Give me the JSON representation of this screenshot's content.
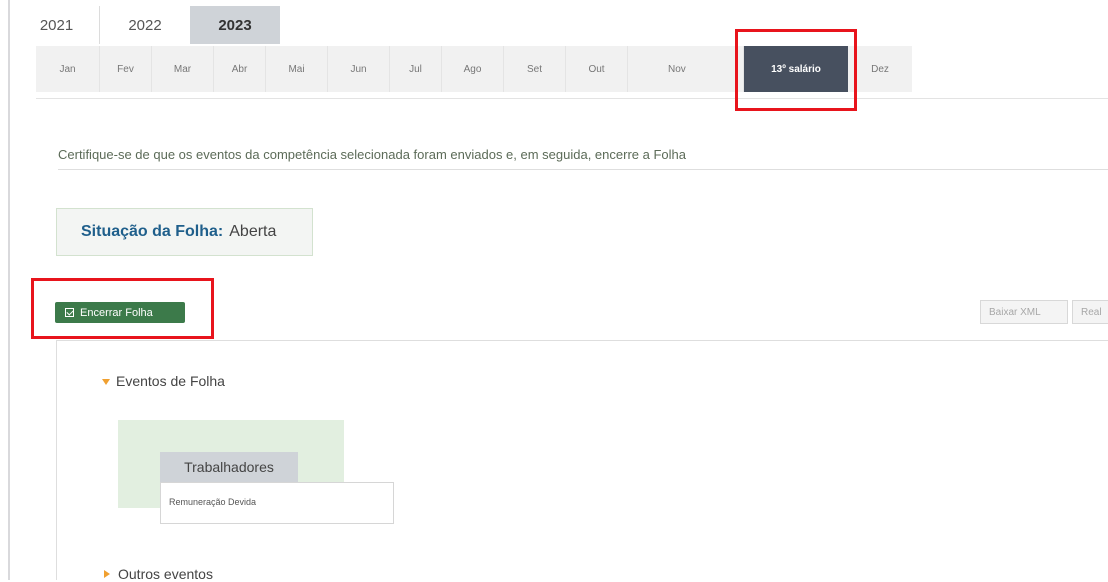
{
  "years": [
    {
      "label": "2021",
      "active": false
    },
    {
      "label": "2022",
      "active": false
    },
    {
      "label": "2023",
      "active": true
    }
  ],
  "months": [
    {
      "label": "Jan",
      "active": false
    },
    {
      "label": "Fev",
      "active": false
    },
    {
      "label": "Mar",
      "active": false
    },
    {
      "label": "Abr",
      "active": false
    },
    {
      "label": "Mai",
      "active": false
    },
    {
      "label": "Jun",
      "active": false
    },
    {
      "label": "Jul",
      "active": false
    },
    {
      "label": "Ago",
      "active": false
    },
    {
      "label": "Set",
      "active": false
    },
    {
      "label": "Out",
      "active": false
    },
    {
      "label": "Nov",
      "active": false
    },
    {
      "label": "13º salário",
      "active": true
    },
    {
      "label": "Dez",
      "active": false
    }
  ],
  "instruction": "Certifique-se de que os eventos da competência selecionada foram enviados e, em seguida, encerre a Folha",
  "status": {
    "label": "Situação da Folha:",
    "value": "Aberta"
  },
  "actions": {
    "close_label": "Encerrar Folha",
    "download_xml_label": "Baixar XML",
    "truncated_label": "Real"
  },
  "sections": {
    "payroll_events": {
      "title": "Eventos de Folha",
      "group_title": "Trabalhadores",
      "item": "Remuneração Devida"
    },
    "other_events": {
      "title": "Outros eventos"
    }
  },
  "colors": {
    "active_month_bg": "#47505f",
    "close_button_bg": "#3c7a4a",
    "highlight_red": "#e8141c",
    "status_label": "#1f5f8b",
    "caret": "#f0a030"
  }
}
